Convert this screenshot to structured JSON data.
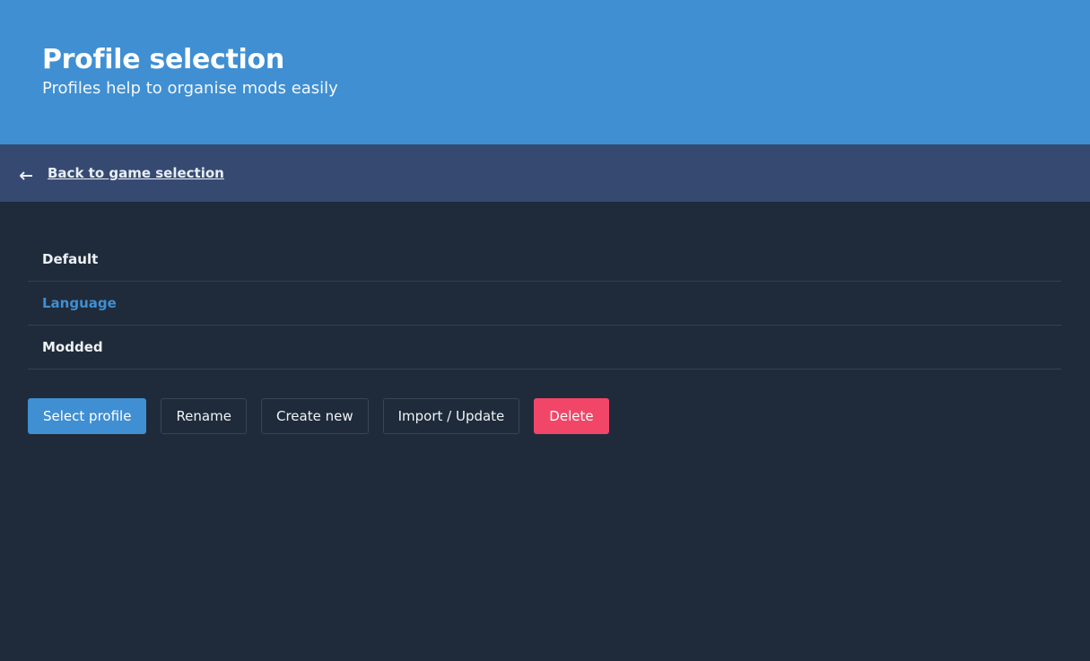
{
  "header": {
    "title": "Profile selection",
    "subtitle": "Profiles help to organise mods easily"
  },
  "nav": {
    "back_icon": "arrow-left-icon",
    "back_label": "Back to game selection"
  },
  "profiles": [
    {
      "name": "Default",
      "selected": false
    },
    {
      "name": "Language",
      "selected": true
    },
    {
      "name": "Modded",
      "selected": false
    }
  ],
  "actions": {
    "select_label": "Select profile",
    "rename_label": "Rename",
    "create_label": "Create new",
    "import_label": "Import / Update",
    "delete_label": "Delete"
  },
  "colors": {
    "header_bg": "#3f8fd2",
    "nav_bg": "#364a71",
    "page_bg": "#1f2b3a",
    "selected_text": "#3f8fd2",
    "danger": "#f14668"
  }
}
